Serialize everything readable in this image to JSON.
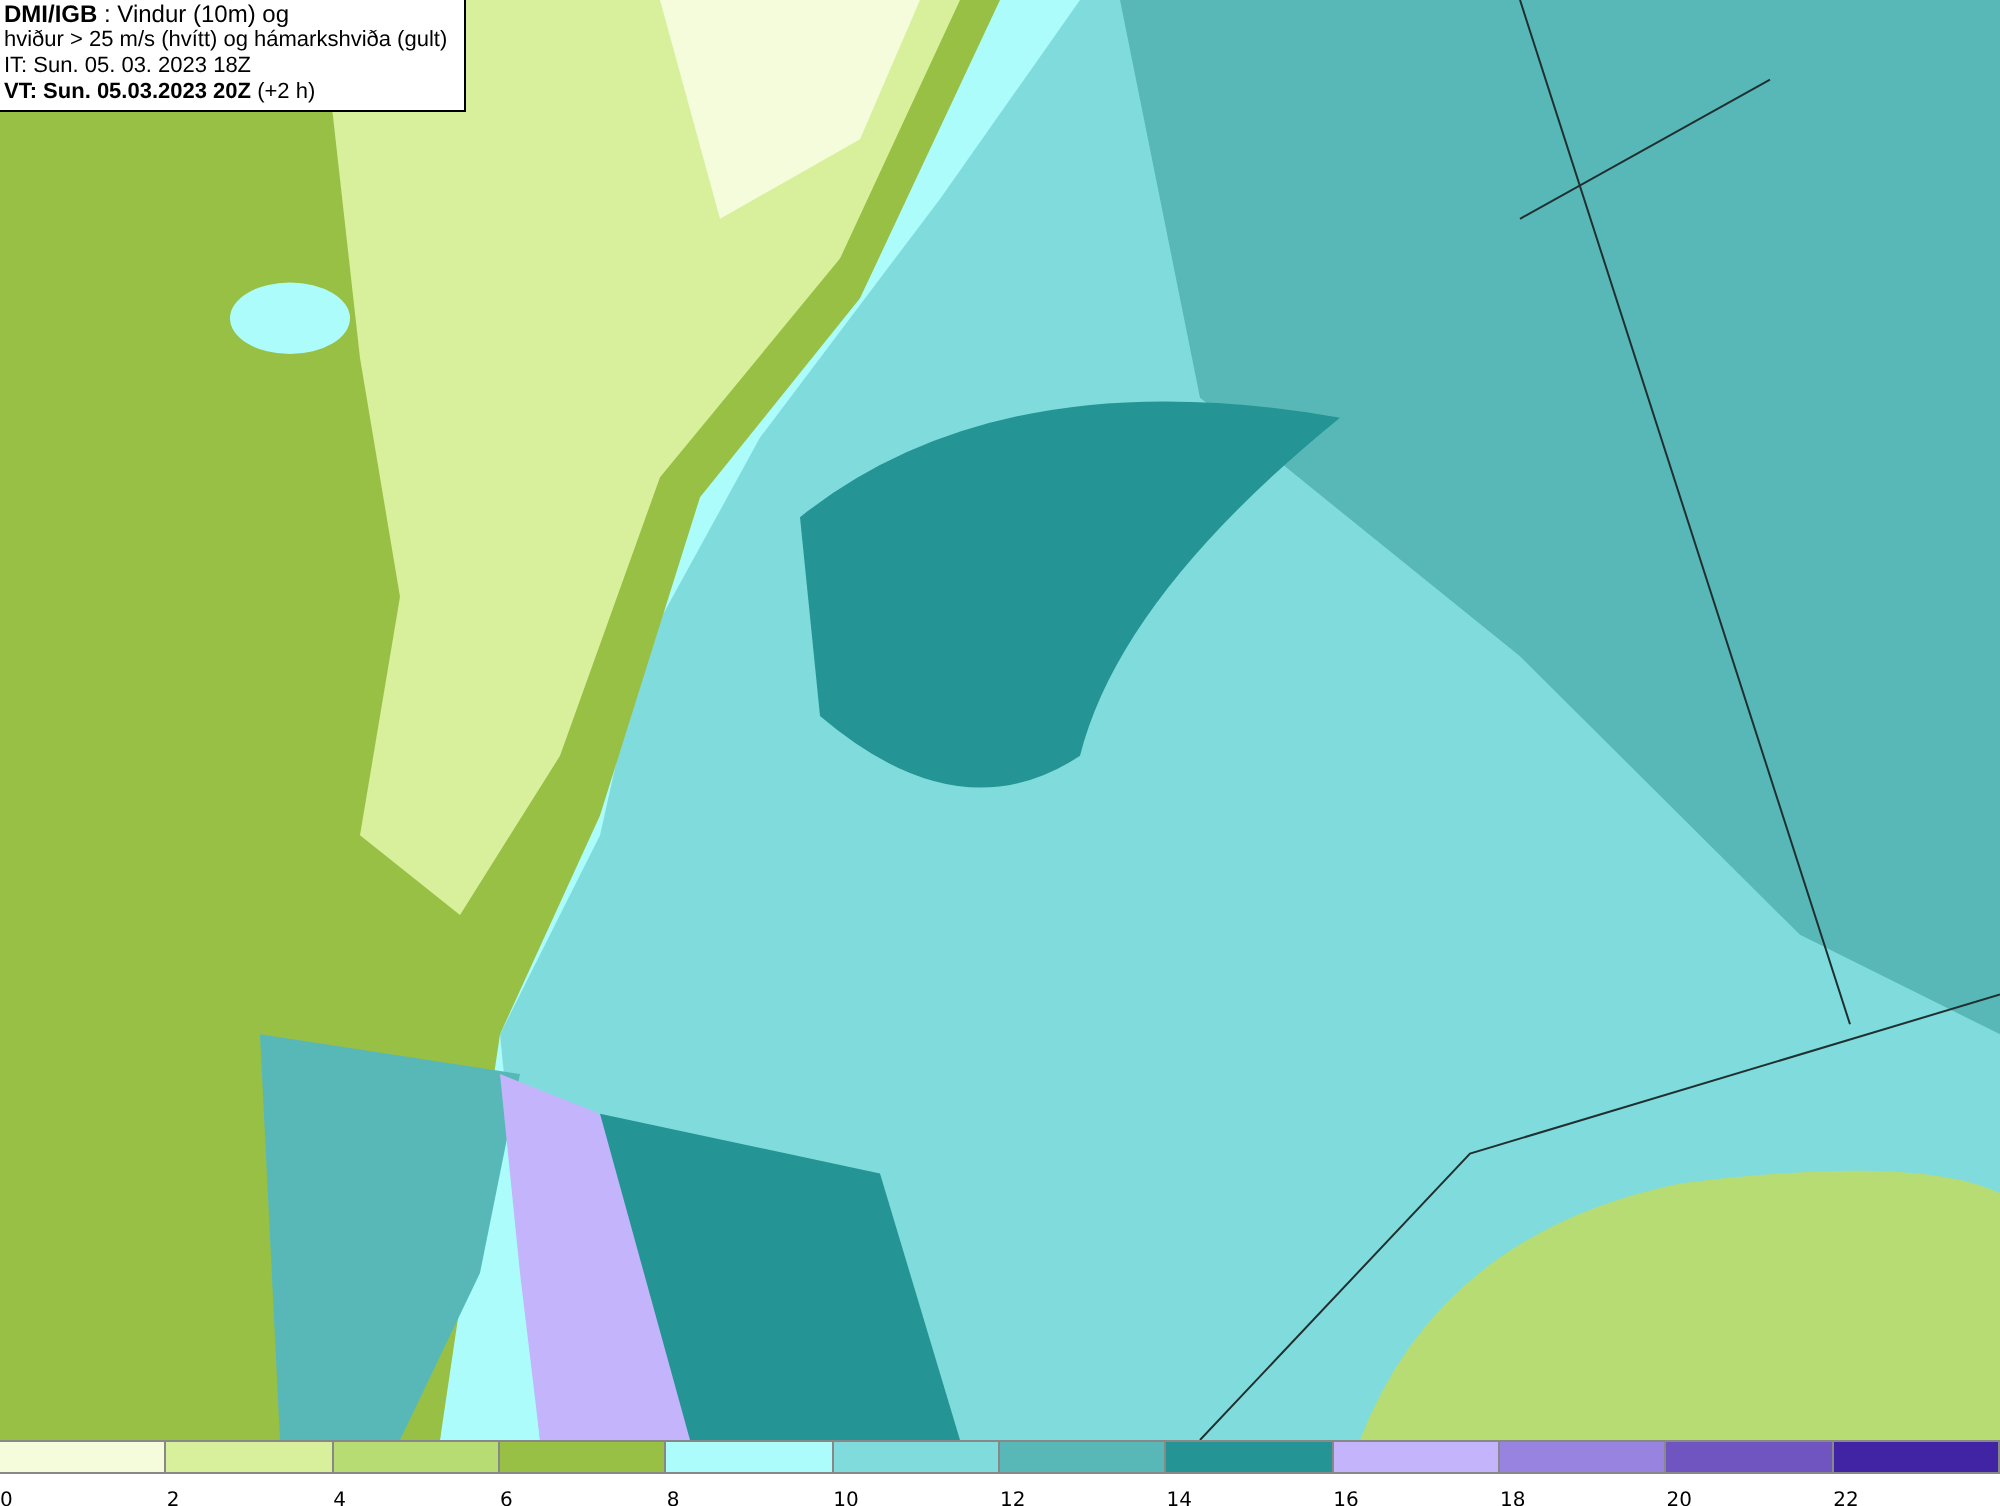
{
  "title_box": {
    "lines": [
      "**DMI/IGB** : Vindur (10m) og",
      "hviður > 25 m/s (hvítt) og hámarkshviða (gult)",
      "IT: Sun. 05. 03. 2023 18Z",
      "**VT: Sun. 05.03.2023 20Z** (+2 h)"
    ]
  },
  "legend": [
    {
      "label": "0",
      "color": "#f4fcdc"
    },
    {
      "label": "2",
      "color": "#d8f09c"
    },
    {
      "label": "4",
      "color": "#b8dc74"
    },
    {
      "label": "6",
      "color": "#98c044"
    },
    {
      "label": "8",
      "color": "#acfcfc"
    },
    {
      "label": "10",
      "color": "#80dcdc"
    },
    {
      "label": "12",
      "color": "#58b8b8"
    },
    {
      "label": "14",
      "color": "#249494"
    },
    {
      "label": "16",
      "color": "#c4b4fc"
    },
    {
      "label": "18",
      "color": "#9884e0"
    },
    {
      "label": "20",
      "color": "#7054c0"
    },
    {
      "label": "22",
      "color": "#4024a4"
    }
  ]
}
